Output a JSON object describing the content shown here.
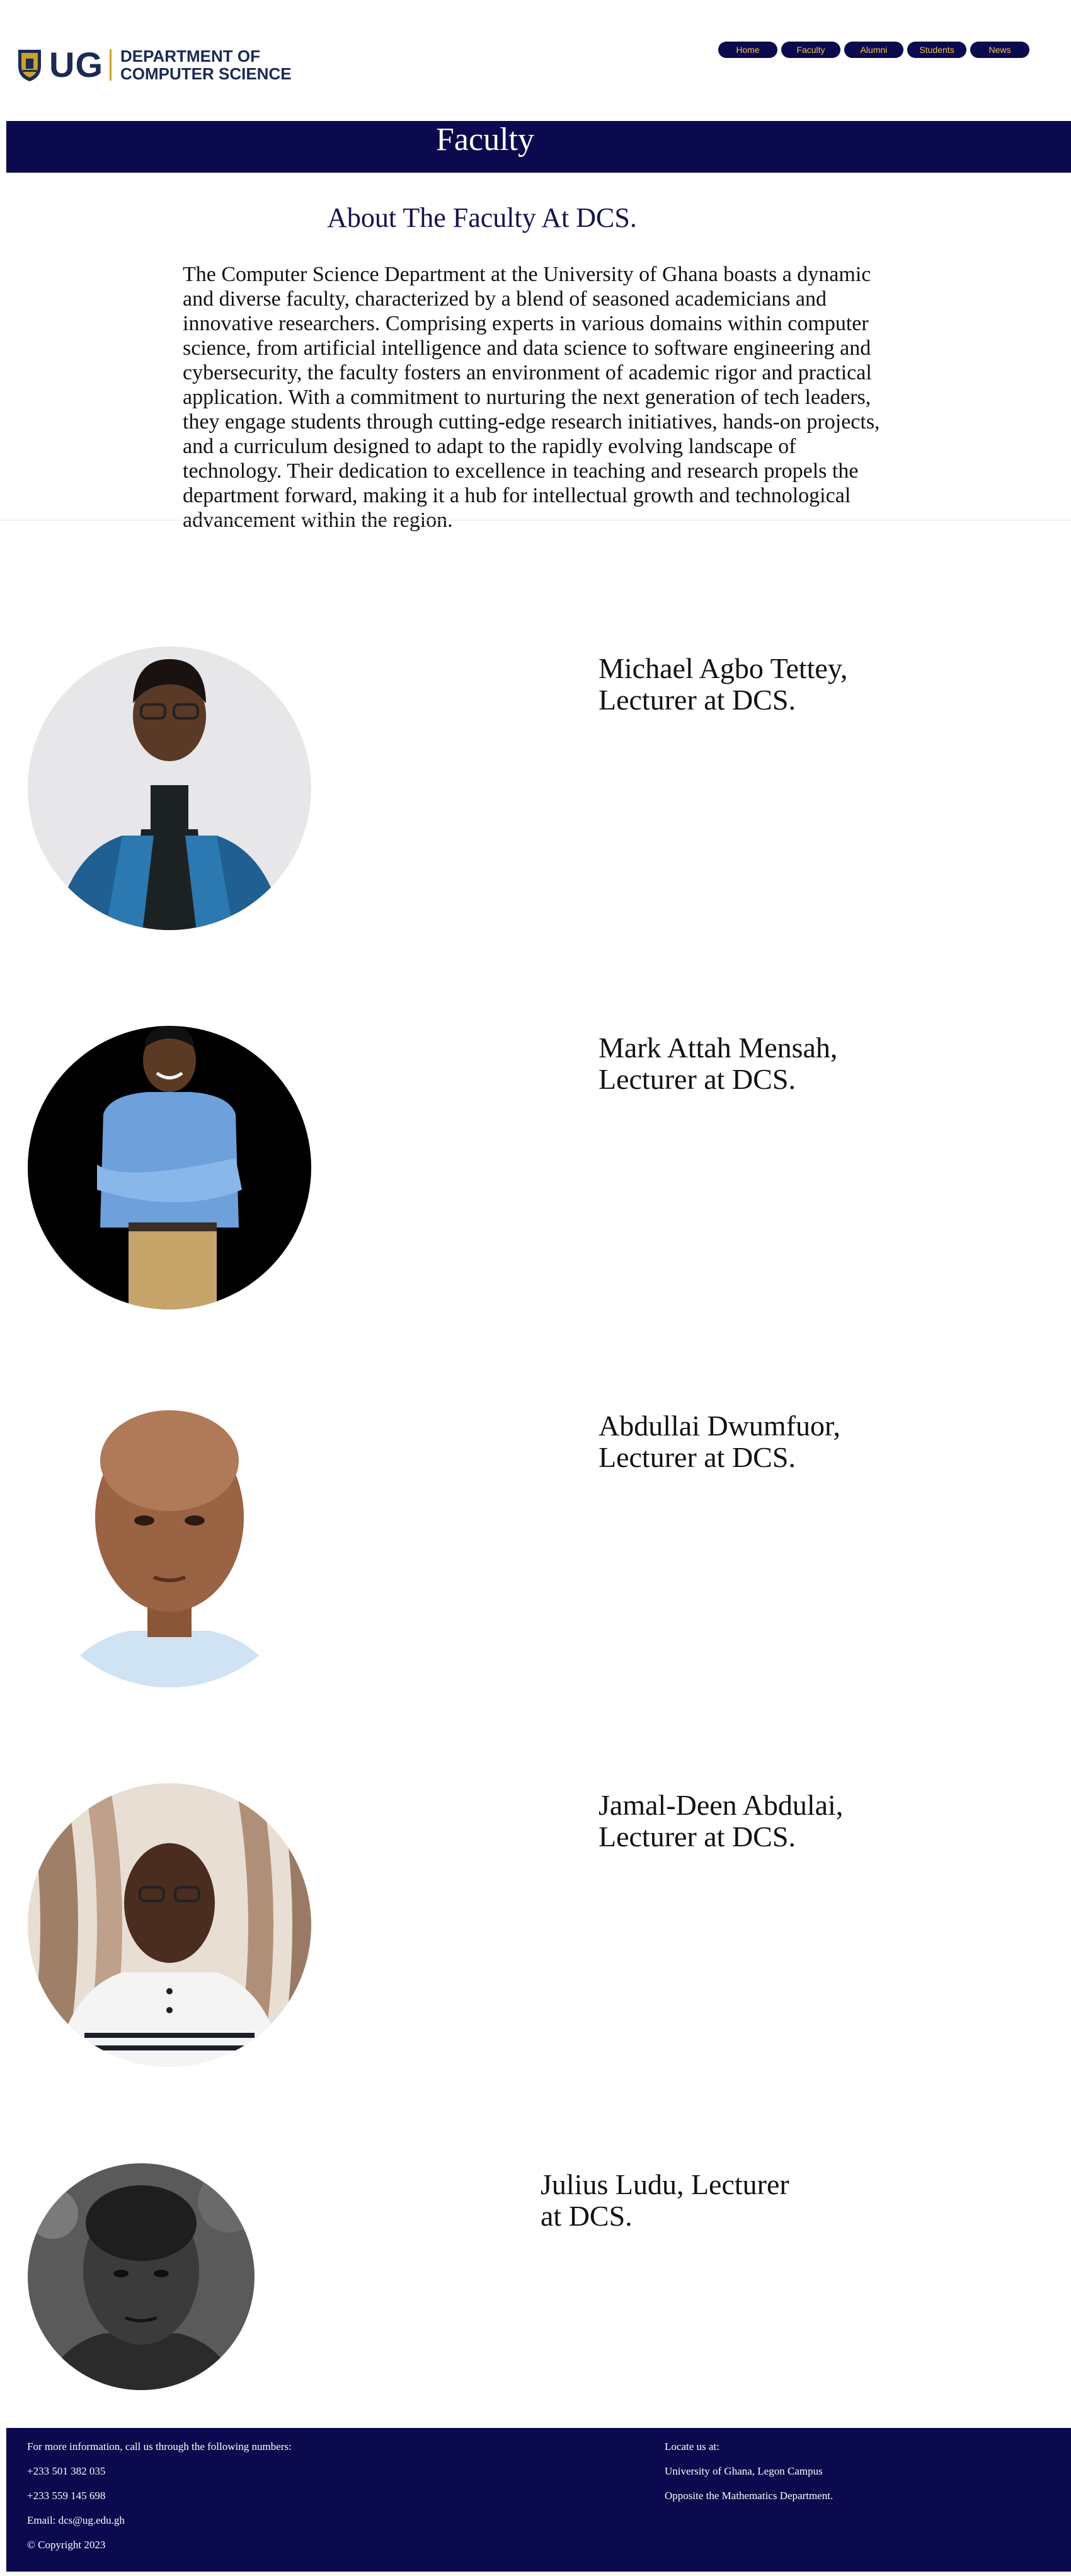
{
  "header": {
    "logo": {
      "mark": "UG",
      "line1": "DEPARTMENT OF",
      "line2": "COMPUTER SCIENCE",
      "icon": "university-crest-icon"
    },
    "nav": [
      {
        "label": "Home"
      },
      {
        "label": "Faculty"
      },
      {
        "label": "Alumni"
      },
      {
        "label": "Students"
      },
      {
        "label": "News"
      }
    ]
  },
  "banner": {
    "title": "Faculty"
  },
  "about": {
    "heading": "About The Faculty At DCS.",
    "text": "The Computer Science Department at the University of Ghana boasts a dynamic and diverse faculty, characterized by a blend of seasoned academicians and innovative researchers. Comprising experts in various domains within computer science, from artificial intelligence and data science to software engineering and cybersecurity, the faculty fosters an environment of academic rigor and practical application. With a commitment to nurturing the next generation of tech leaders, they engage students through cutting-edge research initiatives, hands-on projects, and a curriculum designed to adapt to the rapidly evolving landscape of technology. Their dedication to excellence in teaching and research propels the department forward, making it a hub for intellectual growth and technological advancement within the region."
  },
  "faculty": [
    {
      "caption": "Michael Agbo Tettey, Lecturer at DCS."
    },
    {
      "caption": "Mark Attah Mensah, Lecturer at DCS."
    },
    {
      "caption": "Abdullai Dwumfuor, Lecturer at DCS."
    },
    {
      "caption": "Jamal-Deen Abdulai, Lecturer at DCS."
    },
    {
      "caption": "Julius Ludu, Lecturer at DCS."
    }
  ],
  "footer": {
    "contact_intro": "For more information, call us through the following numbers:",
    "phone1": "+233 501 382 035",
    "phone2": "+233 559 145 698",
    "email": "Email: dcs@ug.edu.gh",
    "copyright": "© Copyright 2023",
    "locate_heading": "Locate us at:",
    "address1": "University of Ghana, Legon Campus",
    "address2": "Opposite the Mathematics Department."
  },
  "colors": {
    "navy": "#0b0a4e",
    "gold": "#f2c24b",
    "logo_blue": "#1b2a55"
  }
}
